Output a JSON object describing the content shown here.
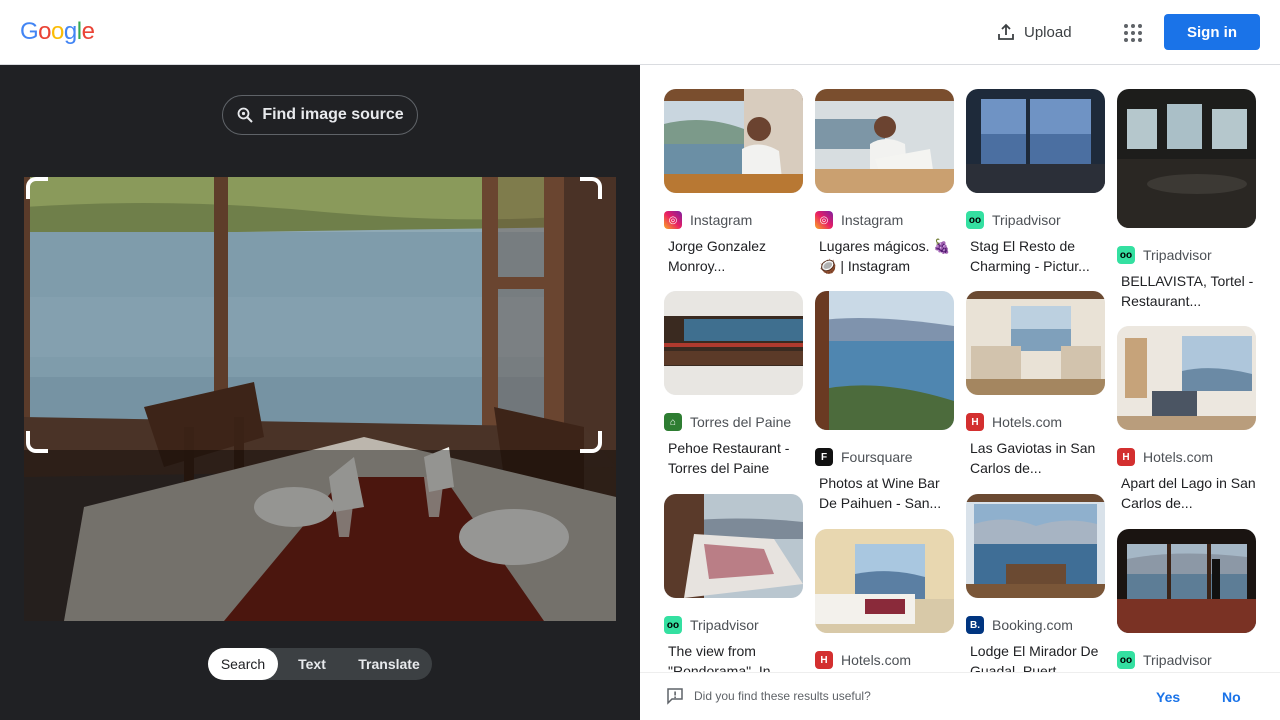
{
  "header": {
    "logo_letters": [
      "G",
      "o",
      "o",
      "g",
      "l",
      "e"
    ],
    "logo_colors": [
      "#4285f4",
      "#ea4335",
      "#fbbc05",
      "#4285f4",
      "#34a853",
      "#ea4335"
    ],
    "upload_label": "Upload",
    "signin_label": "Sign in"
  },
  "left": {
    "find_source_label": "Find image source",
    "modes": [
      "Search",
      "Text",
      "Translate"
    ],
    "active_mode": "Search"
  },
  "results": [
    {
      "source": "Instagram",
      "source_icon": "instagram-icon",
      "title": "Jorge Gonzalez Monroy..."
    },
    {
      "source": "Instagram",
      "source_icon": "instagram-icon",
      "title": "Lugares mágicos. 🍇🥥 | Instagram"
    },
    {
      "source": "Tripadvisor",
      "source_icon": "tripadvisor-icon",
      "title": "Stag El Resto de Charming - Pictur..."
    },
    {
      "source": "Tripadvisor",
      "source_icon": "tripadvisor-icon",
      "title": "BELLAVISTA, Tortel - Restaurant..."
    },
    {
      "source": "Torres del Paine",
      "source_icon": "torres-del-paine-icon",
      "title": "Pehoe Restaurant - Torres del Paine"
    },
    {
      "source": "Foursquare",
      "source_icon": "foursquare-icon",
      "title": "Photos at Wine Bar De Paihuen - San..."
    },
    {
      "source": "Hotels.com",
      "source_icon": "hotels-com-icon",
      "title": "Las Gaviotas in San Carlos de..."
    },
    {
      "source": "Hotels.com",
      "source_icon": "hotels-com-icon",
      "title": "Apart del Lago in San Carlos de..."
    },
    {
      "source": "Tripadvisor",
      "source_icon": "tripadvisor-icon",
      "title": "The view from \"Rondorama\". In..."
    },
    {
      "source": "Hotels.com",
      "source_icon": "hotels-com-icon",
      "title": ""
    },
    {
      "source": "Booking.com",
      "source_icon": "booking-com-icon",
      "title": "Lodge El Mirador De Guadal, Puert..."
    },
    {
      "source": "Tripadvisor",
      "source_icon": "tripadvisor-icon",
      "title": ""
    }
  ],
  "feedback": {
    "question": "Did you find these results useful?",
    "yes": "Yes",
    "no": "No"
  },
  "colors": {
    "accent": "#1a73e8",
    "panel_dark": "#202124"
  }
}
